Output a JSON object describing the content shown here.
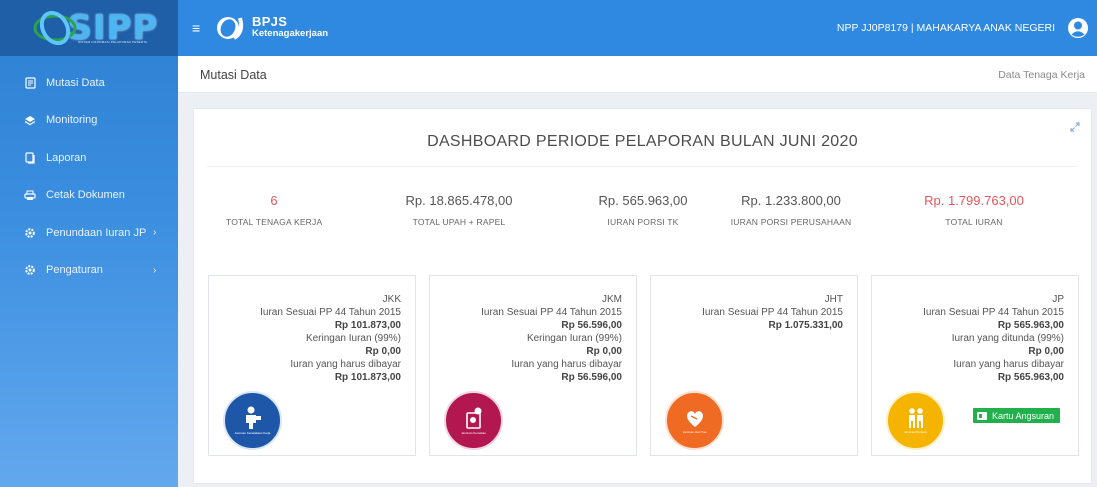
{
  "brand": {
    "logo_text": "SIPP",
    "tagline": "SISTEM INFORMASI PELAPORAN PESERTA"
  },
  "sidebar": {
    "items": [
      {
        "label": "Mutasi Data",
        "icon": "document-icon"
      },
      {
        "label": "Monitoring",
        "icon": "layers-icon"
      },
      {
        "label": "Laporan",
        "icon": "copy-icon"
      },
      {
        "label": "Cetak Dokumen",
        "icon": "print-icon"
      },
      {
        "label": "Penundaan Iuran JP",
        "icon": "gear-icon",
        "has_submenu": true
      },
      {
        "label": "Pengaturan",
        "icon": "gear-icon",
        "has_submenu": true
      }
    ]
  },
  "header": {
    "bpjs_title": "BPJS",
    "bpjs_subtitle": "Ketenagakerjaan",
    "user": "NPP JJ0P8179 | MAHAKARYA ANAK NEGERI"
  },
  "page": {
    "title": "Mutasi Data",
    "breadcrumb": "Data Tenaga Kerja"
  },
  "dashboard": {
    "title": "DASHBOARD PERIODE PELAPORAN BULAN JUNI 2020",
    "stats": [
      {
        "value": "6",
        "label": "TOTAL TENAGA KERJA"
      },
      {
        "value": "Rp. 18.865.478,00",
        "label": "TOTAL UPAH + RAPEL"
      },
      {
        "value": "Rp. 565.963,00",
        "label": "IURAN PORSI TK"
      },
      {
        "value": "Rp. 1.233.800,00",
        "label": "IURAN PORSI PERUSAHAAN"
      },
      {
        "value": "Rp. 1.799.763,00",
        "label": "TOTAL IURAN"
      }
    ],
    "cards": [
      {
        "code": "JKK",
        "lines": [
          "Iuran Sesuai PP 44 Tahun 2015",
          "Rp 101.873,00",
          "Keringan Iuran (99%)",
          "Rp 0,00",
          "Iuran yang harus dibayar",
          "Rp 101.873,00"
        ],
        "badge_caption": "Jaminan Kecelakaan Kerja",
        "color": "#1f57a8"
      },
      {
        "code": "JKM",
        "lines": [
          "Iuran Sesuai PP 44 Tahun 2015",
          "Rp 56.596,00",
          "Keringan Iuran (99%)",
          "Rp 0,00",
          "Iuran yang harus dibayar",
          "Rp 56.596,00"
        ],
        "badge_caption": "Jaminan Kematian",
        "color": "#b3174f"
      },
      {
        "code": "JHT",
        "lines": [
          "Iuran Sesuai PP 44 Tahun 2015",
          "Rp 1.075.331,00"
        ],
        "badge_caption": "Jaminan Hari Tua",
        "color": "#ef6a23"
      },
      {
        "code": "JP",
        "lines": [
          "Iuran Sesuai PP 44 Tahun 2015",
          "Rp 565.963,00",
          "Iuran yang ditunda (99%)",
          "Rp 0,00",
          "Iuran yang harus dibayar",
          "Rp 565.963,00"
        ],
        "badge_caption": "Jaminan Pensiun",
        "color": "#f5b400",
        "button": "Kartu Angsuran"
      }
    ]
  },
  "colors": {
    "accent_red": "#e0575c",
    "topbar": "#2f89e0",
    "button_green": "#21b04b"
  }
}
